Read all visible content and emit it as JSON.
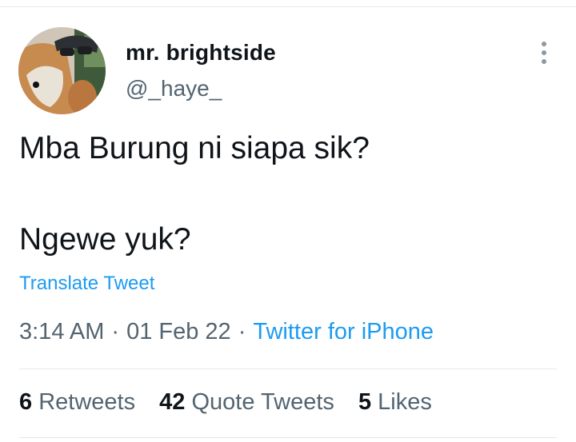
{
  "author": {
    "display_name": "mr. brightside",
    "handle": "@_haye_",
    "avatar_icon": "avatar-dog-with-cap"
  },
  "more_icon": "more-options-vertical-icon",
  "tweet": {
    "line1": "Mba Burung ni siapa sik?",
    "line2": "Ngewe yuk?"
  },
  "translate_label": "Translate Tweet",
  "meta": {
    "time": "3:14 AM",
    "separator": "·",
    "date": "01 Feb 22",
    "source": "Twitter for iPhone"
  },
  "stats": {
    "retweets_count": "6",
    "retweets_label": "Retweets",
    "quotes_count": "42",
    "quotes_label": "Quote Tweets",
    "likes_count": "5",
    "likes_label": "Likes"
  },
  "colors": {
    "text_primary": "#0f1419",
    "text_secondary": "#536471",
    "link": "#1d9bf0",
    "divider": "#e7e9ea"
  }
}
